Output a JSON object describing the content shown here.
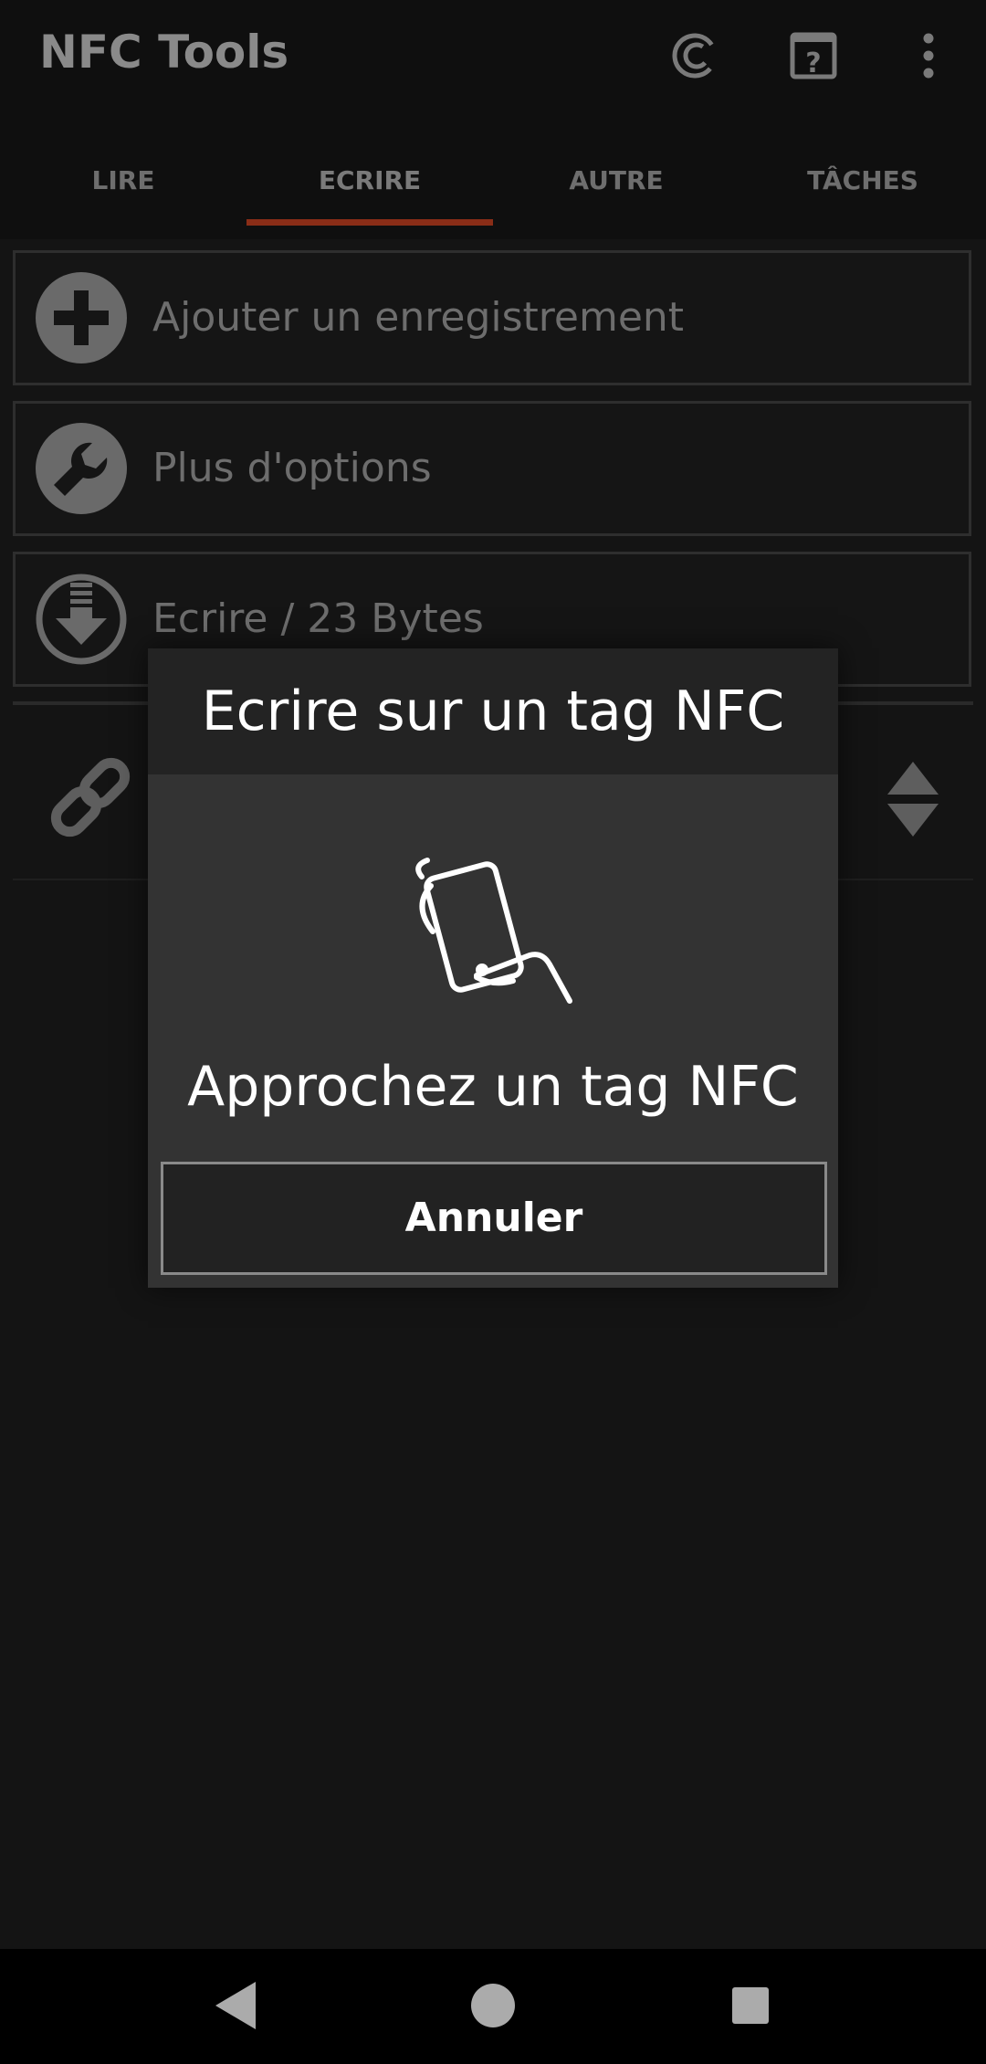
{
  "appbar": {
    "title": "NFC Tools",
    "icons": [
      "credits-icon",
      "help-icon",
      "more-vert-icon"
    ]
  },
  "tabs": [
    {
      "label": "LIRE",
      "selected": false
    },
    {
      "label": "ECRIRE",
      "selected": true
    },
    {
      "label": "AUTRE",
      "selected": false
    },
    {
      "label": "TÂCHES",
      "selected": false
    }
  ],
  "actions": [
    {
      "label": "Ajouter un enregistrement",
      "icon": "add-circle-icon"
    },
    {
      "label": "Plus d'options",
      "icon": "wrench-icon"
    },
    {
      "label": "Ecrire / 23 Bytes",
      "icon": "download-icon"
    }
  ],
  "record": {
    "icon": "link-icon",
    "reorder_icon": "reorder-icon"
  },
  "dialog": {
    "title": "Ecrire sur un tag NFC",
    "message": "Approchez un tag NFC",
    "cancel_label": "Annuler",
    "illustration_icon": "nfc-phone-hand-icon"
  },
  "colors": {
    "accent": "#8a2d17",
    "background": "#141414",
    "dialog_bg": "#333333"
  }
}
